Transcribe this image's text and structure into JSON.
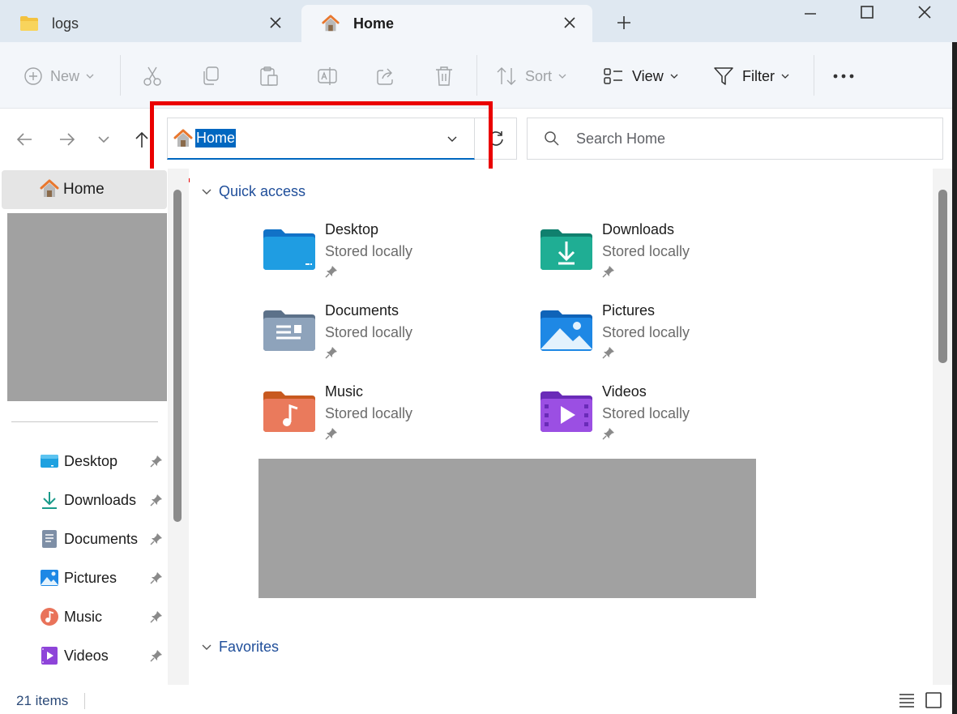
{
  "tabs": [
    {
      "label": "logs",
      "icon": "folder-icon",
      "active": false
    },
    {
      "label": "Home",
      "icon": "home-icon",
      "active": true
    }
  ],
  "window_controls": [
    "minimize-icon",
    "maximize-icon",
    "close-icon"
  ],
  "toolbar": {
    "new_label": "New",
    "sort_label": "Sort",
    "view_label": "View",
    "filter_label": "Filter",
    "icons": [
      "cut-icon",
      "copy-icon",
      "paste-icon",
      "rename-icon",
      "share-icon",
      "delete-icon",
      "more-icon"
    ]
  },
  "address": {
    "path": "Home",
    "search_placeholder": "Search Home"
  },
  "sidebar": {
    "home_label": "Home",
    "items": [
      {
        "label": "Desktop",
        "icon": "desktop-icon"
      },
      {
        "label": "Downloads",
        "icon": "downloads-icon"
      },
      {
        "label": "Documents",
        "icon": "documents-icon"
      },
      {
        "label": "Pictures",
        "icon": "pictures-icon"
      },
      {
        "label": "Music",
        "icon": "music-icon"
      },
      {
        "label": "Videos",
        "icon": "videos-icon"
      }
    ]
  },
  "main": {
    "quick_access_label": "Quick access",
    "favorites_label": "Favorites",
    "quick_access": [
      {
        "name": "Desktop",
        "status": "Stored locally"
      },
      {
        "name": "Downloads",
        "status": "Stored locally"
      },
      {
        "name": "Documents",
        "status": "Stored locally"
      },
      {
        "name": "Pictures",
        "status": "Stored locally"
      },
      {
        "name": "Music",
        "status": "Stored locally"
      },
      {
        "name": "Videos",
        "status": "Stored locally"
      }
    ]
  },
  "status": {
    "item_count": "21 items"
  },
  "colors": {
    "accent": "#0067c0",
    "highlight_box": "#ea0000",
    "redacted": "#a1a1a1",
    "section_heading": "#1f4e9a"
  }
}
